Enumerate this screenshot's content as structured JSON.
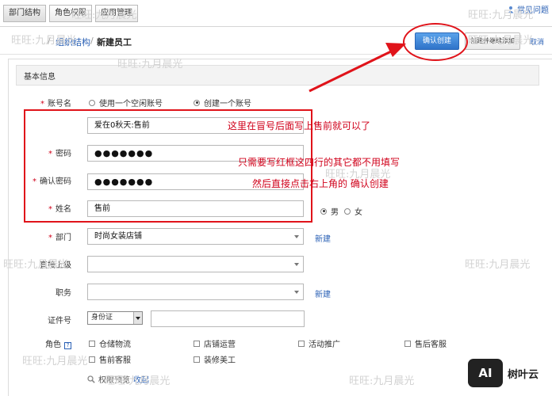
{
  "tabs": [
    {
      "label": "部门结构"
    },
    {
      "label": "角色权限"
    },
    {
      "label": "应用管理"
    }
  ],
  "help": {
    "label": "常见问题"
  },
  "breadcrumb": {
    "root": "",
    "parent": "组织结构",
    "separator": "/",
    "current": "新建员工"
  },
  "actions": {
    "confirm": "确认创建",
    "create_continue": "创建并继续添加",
    "cancel": "取消"
  },
  "section": {
    "title": "基本信息"
  },
  "form": {
    "account": {
      "label": "账号名",
      "option_existing": "使用一个空闲账号",
      "option_new": "创建一个账号",
      "selected": "创建一个账号",
      "value": "爱在0秋天:售前"
    },
    "password": {
      "label": "密码",
      "value": "●●●●●●●"
    },
    "confirm_password": {
      "label": "确认密码",
      "value": "●●●●●●●"
    },
    "name": {
      "label": "姓名",
      "value": "售前"
    },
    "gender": {
      "male": "男",
      "female": "女",
      "selected": "男"
    },
    "department": {
      "label": "部门",
      "value": "时尚女装店铺",
      "new_link": "新建"
    },
    "supervisor": {
      "label": "直接上级",
      "value": ""
    },
    "position": {
      "label": "职务",
      "value": "",
      "new_link": "新建"
    },
    "id_card": {
      "label": "证件号",
      "type_value": "身份证",
      "number": ""
    },
    "roles": {
      "label": "角色",
      "items": [
        "仓储物流",
        "店铺运营",
        "活动推广",
        "售后客服",
        "售前客服",
        "装修美工"
      ]
    },
    "permission": {
      "label": "权限预览",
      "link": "收起"
    }
  },
  "annotations": {
    "line1": "这里在冒号后面写上售前就可以了",
    "line2": "只需要写红框这四行的其它都不用填写",
    "line3": "然后直接点击右上角的  确认创建"
  },
  "watermark": "旺旺:九月晨光",
  "logo": {
    "mark": "AI",
    "text": "树叶云"
  },
  "colors": {
    "accent": "#2f73c9",
    "link": "#2a60b5",
    "annotation": "#e0131a"
  }
}
